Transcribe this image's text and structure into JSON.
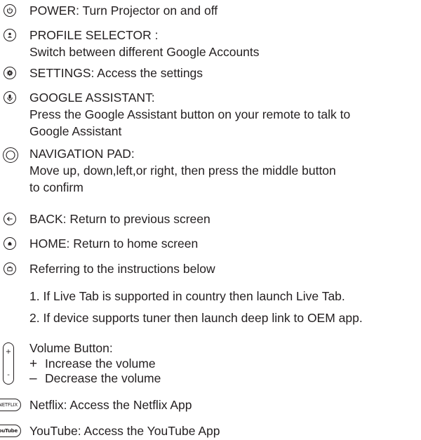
{
  "items": [
    {
      "icon": "power-icon",
      "lines": [
        "POWER: Turn Projector on and off"
      ]
    },
    {
      "icon": "profile-icon",
      "lines": [
        "PROFILE SELECTOR :",
        "Switch between different Google Accounts"
      ]
    },
    {
      "icon": "settings-gear-icon",
      "lines": [
        "SETTINGS: Access the settings"
      ]
    },
    {
      "icon": "microphone-icon",
      "lines": [
        "GOOGLE ASSISTANT:",
        "Press the Google Assistant button on your remote to talk to",
        "Google Assistant"
      ]
    },
    {
      "icon": "navigation-ring-icon",
      "lines": [
        "NAVIGATION PAD:",
        "Move up, down,left,or right, then press the middle button",
        "to confirm"
      ]
    },
    {
      "icon": "back-arrow-icon",
      "lines": [
        "BACK: Return to previous screen"
      ]
    },
    {
      "icon": "home-icon",
      "lines": [
        "HOME: Return to home screen"
      ]
    },
    {
      "icon": "tv-icon",
      "lines": [
        "Referring to the instructions below"
      ]
    }
  ],
  "instructions": [
    "1. If Live Tab is supported in country then launch Live Tab.",
    "2. If device supports tuner then launch deep link to OEM app."
  ],
  "volume": {
    "title": "Volume Button:",
    "plus_symbol": "+",
    "plus_text": "Increase the volume",
    "minus_symbol": "–",
    "minus_text": "Decrease the volume",
    "icon_plus": "+",
    "icon_minus": "-"
  },
  "netflix": {
    "badge": "NETFLIX",
    "text": "Netflix: Access the Netflix App"
  },
  "youtube": {
    "badge": "YouTube",
    "text": "YouTube: Access the YouTube App"
  }
}
